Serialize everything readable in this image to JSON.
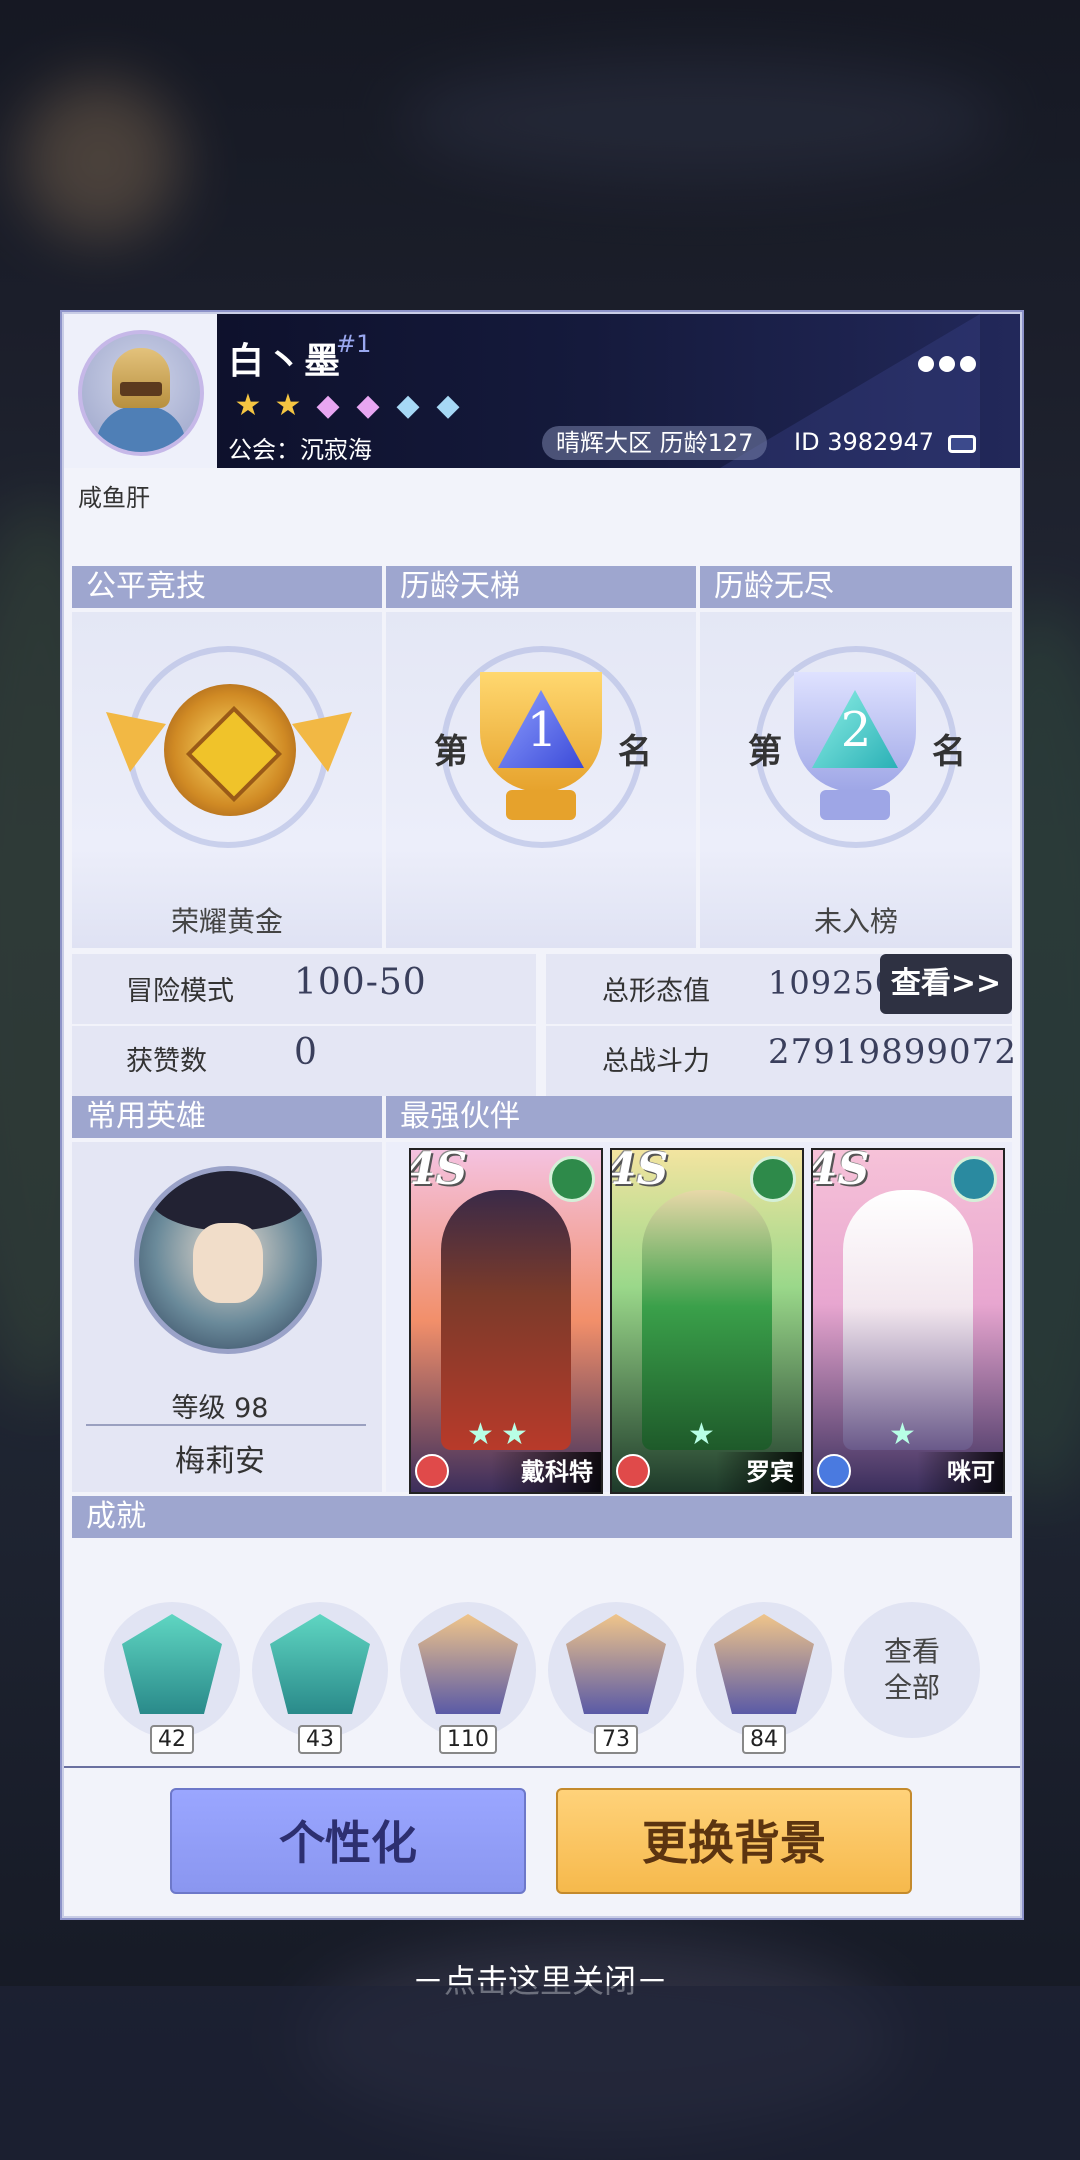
{
  "profile": {
    "name": "白丶墨",
    "rank_tag": "#1",
    "stars": [
      "gold",
      "gold",
      "pink",
      "pink",
      "blue",
      "blue"
    ],
    "guild": "公会：沉寂海",
    "region": "晴辉大区  历龄127",
    "id": "ID 3982947",
    "signature": "咸鱼肝"
  },
  "ranks": [
    {
      "title": "公平竞技",
      "result": "荣耀黄金"
    },
    {
      "title": "历龄天梯",
      "prefix": "第",
      "place": "1",
      "suffix": "名"
    },
    {
      "title": "历龄无尽",
      "prefix": "第",
      "place": "2",
      "suffix": "名",
      "result": "未入榜"
    }
  ],
  "stats": {
    "adventure_label": "冒险模式",
    "adventure_value": "100-50",
    "likes_label": "获赞数",
    "likes_value": "0",
    "form_label": "总形态值",
    "form_value": "109250",
    "power_label": "总战斗力",
    "power_value": "27919899072",
    "view_button": "查看>>"
  },
  "favorite_hero": {
    "section_title": "常用英雄",
    "level": "等级 98",
    "name": "梅莉安"
  },
  "partners": {
    "section_title": "最强伙伴",
    "items": [
      {
        "grade": "4S",
        "name": "戴科特",
        "stars": 2
      },
      {
        "grade": "4S",
        "name": "罗宾",
        "stars": 1
      },
      {
        "grade": "4S",
        "name": "咪可",
        "stars": 1
      }
    ]
  },
  "achievements": {
    "section_title": "成就",
    "items": [
      {
        "count": "42"
      },
      {
        "count": "43"
      },
      {
        "count": "110"
      },
      {
        "count": "73"
      },
      {
        "count": "84"
      }
    ],
    "view_all": "查看\n全部"
  },
  "buttons": {
    "customize": "个性化",
    "change_bg": "更换背景"
  },
  "close_hint": "－点击这里关闭－",
  "colors": {
    "section_header": "#9ea6cf",
    "customize_button": "#9aa6ff",
    "change_bg_button": "#f6b94c"
  }
}
